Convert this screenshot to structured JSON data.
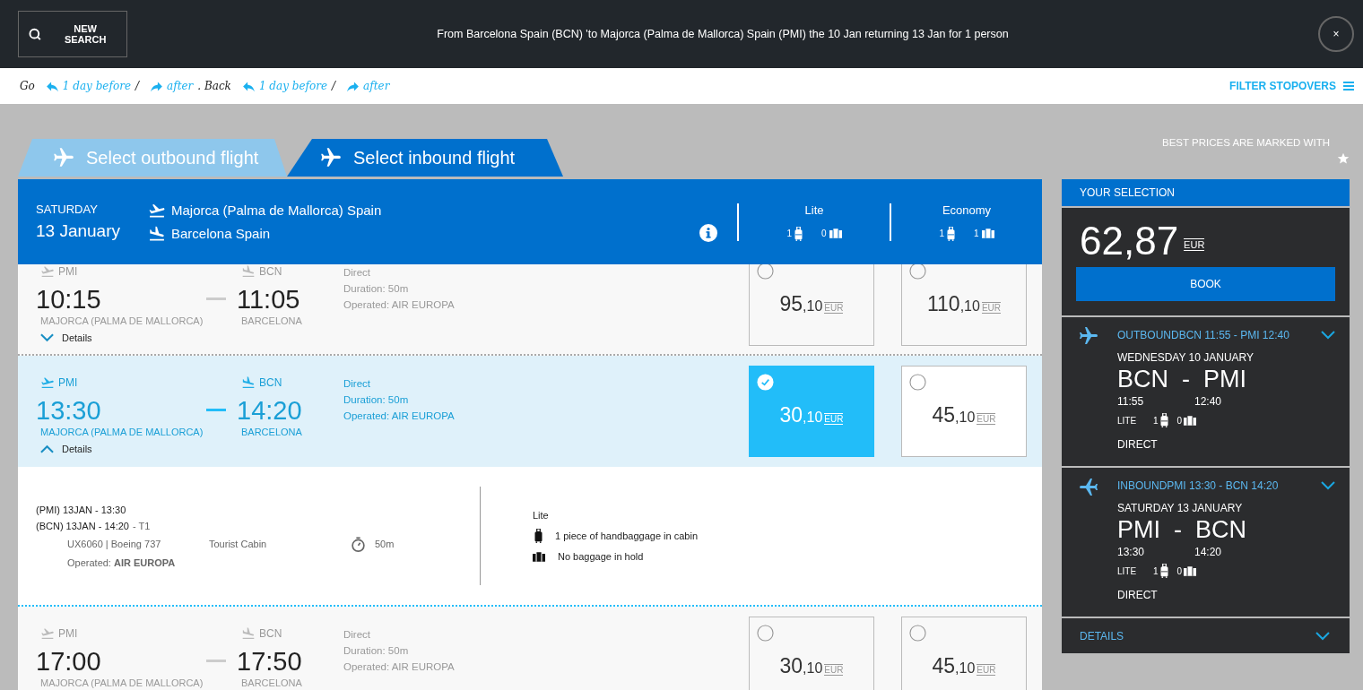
{
  "top_bar": {
    "new_search": "NEW SEARCH",
    "summary": "From Barcelona Spain (BCN) 'to Majorca (Palma de Mallorca) Spain (PMI) the 10 Jan returning 13 Jan for 1 person",
    "close": "×"
  },
  "date_nav": {
    "go": "Go",
    "go_before": "1 day before",
    "go_sep": "/",
    "go_after": "after",
    "back": ". Back",
    "back_before": "1 day before",
    "back_sep": "/",
    "back_after": "after",
    "filter": "FILTER STOPOVERS"
  },
  "best_prices": "BEST PRICES ARE MARKED WITH",
  "tabs": [
    {
      "label": "Select outbound flight",
      "selected": false
    },
    {
      "label": "Select inbound flight",
      "selected": true
    }
  ],
  "list_header": {
    "day": "SATURDAY",
    "date": "13 January",
    "from": "Majorca (Palma de Mallorca) Spain",
    "to": "Barcelona Spain",
    "fares": [
      {
        "name": "Lite",
        "hand": "1",
        "hold": "0"
      },
      {
        "name": "Economy",
        "hand": "1",
        "hold": "1"
      }
    ]
  },
  "flights": [
    {
      "selected": false,
      "expanded": false,
      "from_code": "PMI",
      "dep": "10:15",
      "from_city": "MAJORCA (PALMA DE MALLORCA)",
      "to_code": "BCN",
      "arr": "11:05",
      "to_city": "BARCELONA",
      "stops": "Direct",
      "duration": "Duration: 50m",
      "operated": "Operated: AIR EUROPA",
      "details": "Details",
      "prices": [
        {
          "whole": "95",
          "decimals": ",10",
          "currency": "EUR",
          "selected": false
        },
        {
          "whole": "110",
          "decimals": ",10",
          "currency": "EUR",
          "selected": false
        }
      ]
    },
    {
      "selected": true,
      "expanded": true,
      "from_code": "PMI",
      "dep": "13:30",
      "from_city": "MAJORCA (PALMA DE MALLORCA)",
      "to_code": "BCN",
      "arr": "14:20",
      "to_city": "BARCELONA",
      "stops": "Direct",
      "duration": "Duration: 50m",
      "operated": "Operated: AIR EUROPA",
      "details": "Details",
      "prices": [
        {
          "whole": "30",
          "decimals": ",10",
          "currency": "EUR",
          "selected": true
        },
        {
          "whole": "45",
          "decimals": ",10",
          "currency": "EUR",
          "selected": false
        }
      ],
      "detail": {
        "departure": "(PMI) 13JAN - 13:30",
        "arrival": "(BCN) 13JAN - 14:20",
        "terminal": "- T1",
        "flight_no": "UX6060 | Boeing 737",
        "cabin": "Tourist Cabin",
        "duration": "50m",
        "operated": "Operated: **AIR EUROPA**",
        "fare": "Lite",
        "baggage": [
          {
            "kind": "hand",
            "text": "1 piece of handbaggage in cabin"
          },
          {
            "kind": "hold",
            "text": "No baggage in hold"
          }
        ]
      }
    },
    {
      "selected": false,
      "expanded": false,
      "from_code": "PMI",
      "dep": "17:00",
      "from_city": "MAJORCA (PALMA DE MALLORCA)",
      "to_code": "BCN",
      "arr": "17:50",
      "to_city": "BARCELONA",
      "stops": "Direct",
      "duration": "Duration: 50m",
      "operated": "Operated: AIR EUROPA",
      "prices": [
        {
          "whole": "30",
          "decimals": ",10",
          "currency": "EUR",
          "selected": false
        },
        {
          "whole": "45",
          "decimals": ",10",
          "currency": "EUR",
          "selected": false
        }
      ]
    }
  ],
  "selection": {
    "title": "YOUR SELECTION",
    "total": "62,87",
    "currency": "EUR",
    "book": "BOOK",
    "legs": [
      {
        "kind": "outbound",
        "heading": "OUTBOUNDBCN 11:55 - PMI 12:40",
        "date": "WEDNESDAY 10 JANUARY",
        "route": "BCN  -  PMI",
        "dep": "11:55",
        "arr": "12:40",
        "fare": "LITE",
        "hand": "1",
        "hold": "0",
        "stops": "DIRECT"
      },
      {
        "kind": "inbound",
        "heading": "INBOUNDPMI 13:30 - BCN 14:20",
        "date": "SATURDAY 13 JANUARY",
        "route": "PMI  -  BCN",
        "dep": "13:30",
        "arr": "14:20",
        "fare": "LITE",
        "hand": "1",
        "hold": "0",
        "stops": "DIRECT"
      }
    ],
    "details": "DETAILS"
  }
}
